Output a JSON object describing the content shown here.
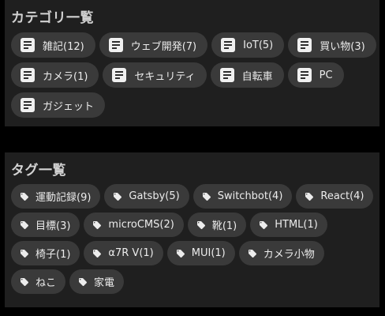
{
  "categories": {
    "title": "カテゴリ一覧",
    "items": [
      {
        "label": "雑記(12)"
      },
      {
        "label": "ウェブ開発(7)"
      },
      {
        "label": "IoT(5)"
      },
      {
        "label": "買い物(3)"
      },
      {
        "label": "カメラ(1)"
      },
      {
        "label": "セキュリティ"
      },
      {
        "label": "自転車"
      },
      {
        "label": "PC"
      },
      {
        "label": "ガジェット"
      }
    ]
  },
  "tags": {
    "title": "タグ一覧",
    "items": [
      {
        "label": "運動記録(9)"
      },
      {
        "label": "Gatsby(5)"
      },
      {
        "label": "Switchbot(4)"
      },
      {
        "label": "React(4)"
      },
      {
        "label": "目標(3)"
      },
      {
        "label": "microCMS(2)"
      },
      {
        "label": "靴(1)"
      },
      {
        "label": "HTML(1)"
      },
      {
        "label": "椅子(1)"
      },
      {
        "label": "α7R V(1)"
      },
      {
        "label": "MUI(1)"
      },
      {
        "label": "カメラ小物"
      },
      {
        "label": "ねこ"
      },
      {
        "label": "家電"
      }
    ]
  },
  "icons": {
    "category_icon": "document-icon",
    "tag_icon": "tag-icon"
  },
  "colors": {
    "page_background": "#000000",
    "panel_background": "#1f1f1f",
    "chip_background": "#3a3a3a",
    "text": "#ececec"
  }
}
